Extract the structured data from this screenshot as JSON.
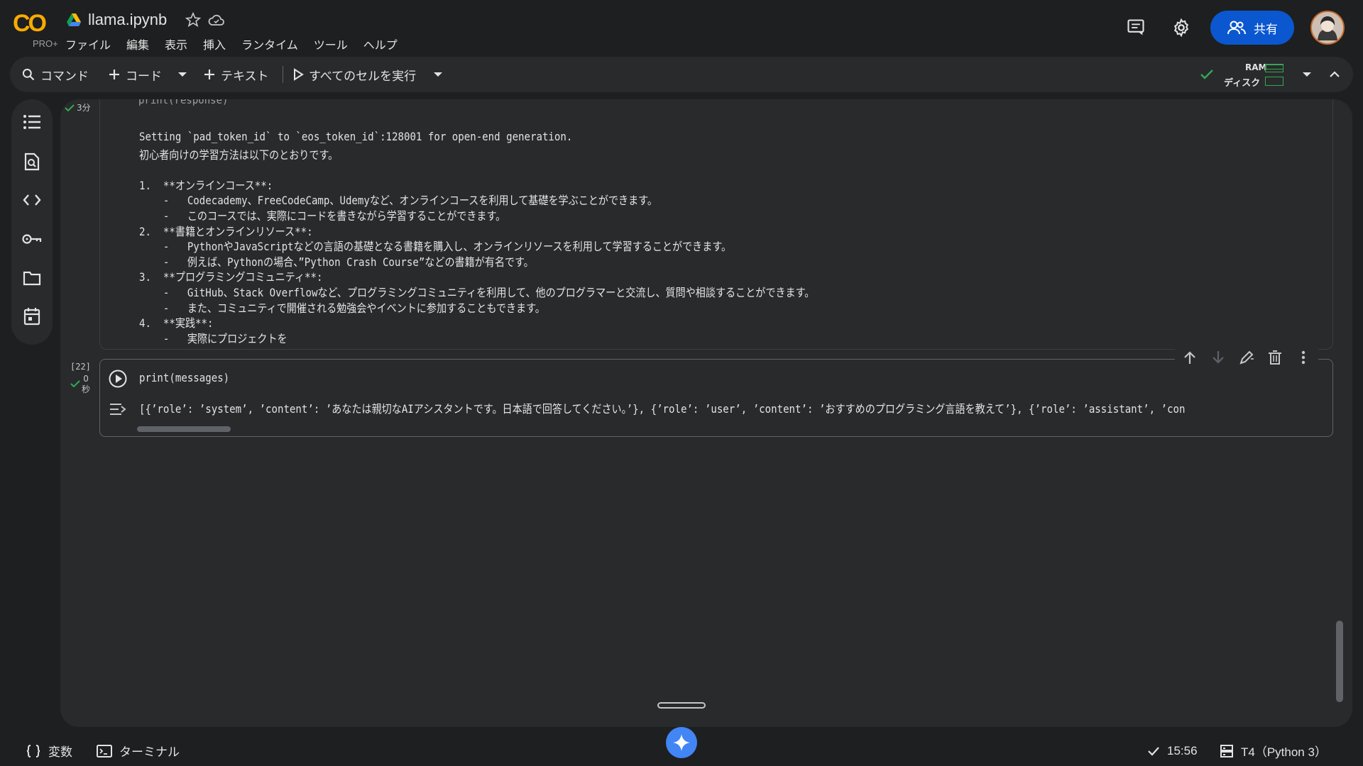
{
  "app": {
    "logo_text": "CO",
    "logo_sub": "PRO+",
    "doc_title": "llama.ipynb"
  },
  "menu": [
    "ファイル",
    "編集",
    "表示",
    "挿入",
    "ランタイム",
    "ツール",
    "ヘルプ"
  ],
  "header": {
    "share_label": "共有"
  },
  "toolbar": {
    "command_label": "コマンド",
    "code_label": "コード",
    "text_label": "テキスト",
    "run_all_label": "すべてのセルを実行",
    "ram_label": "RAM",
    "disk_label": "ディスク"
  },
  "cell1": {
    "exec_time": "3分",
    "output_lines": [
      "Setting `pad_token_id` to `eos_token_id`:128001 for open-end generation.",
      "初心者向けの学習方法は以下のとおりです。",
      "",
      "1.  **オンラインコース**:",
      "    -   Codecademy、FreeCodeCamp、Udemyなど、オンラインコースを利用して基礎を学ぶことができます。",
      "    -   このコースでは、実際にコードを書きながら学習することができます。",
      "2.  **書籍とオンラインリソース**:",
      "    -   PythonやJavaScriptなどの言語の基礎となる書籍を購入し、オンラインリソースを利用して学習することができます。",
      "    -   例えば、Pythonの場合、”Python Crash Course”などの書籍が有名です。",
      "3.  **プログラミングコミュニティ**:",
      "    -   GitHub、Stack Overflowなど、プログラミングコミュニティを利用して、他のプログラマーと交流し、質問や相談することができます。",
      "    -   また、コミュニティで開催される勉強会やイベントに参加することもできます。",
      "4.  **実践**:",
      "    -   実際にプロジェクトを"
    ]
  },
  "cell2": {
    "exec_count": "[22]",
    "exec_time_num": "0",
    "exec_time_unit": "秒",
    "code": "print(messages)",
    "output": "[{’role’: ’system’, ’content’: ’あなたは親切なAIアシスタントです。日本語で回答してください。’}, {’role’: ’user’, ’content’: ’おすすめのプログラミング言語を教えて’}, {’role’: ’assistant’, ’con"
  },
  "footer": {
    "variables_label": "変数",
    "terminal_label": "ターミナル",
    "time": "15:56",
    "runtime": "T4（Python 3）"
  }
}
